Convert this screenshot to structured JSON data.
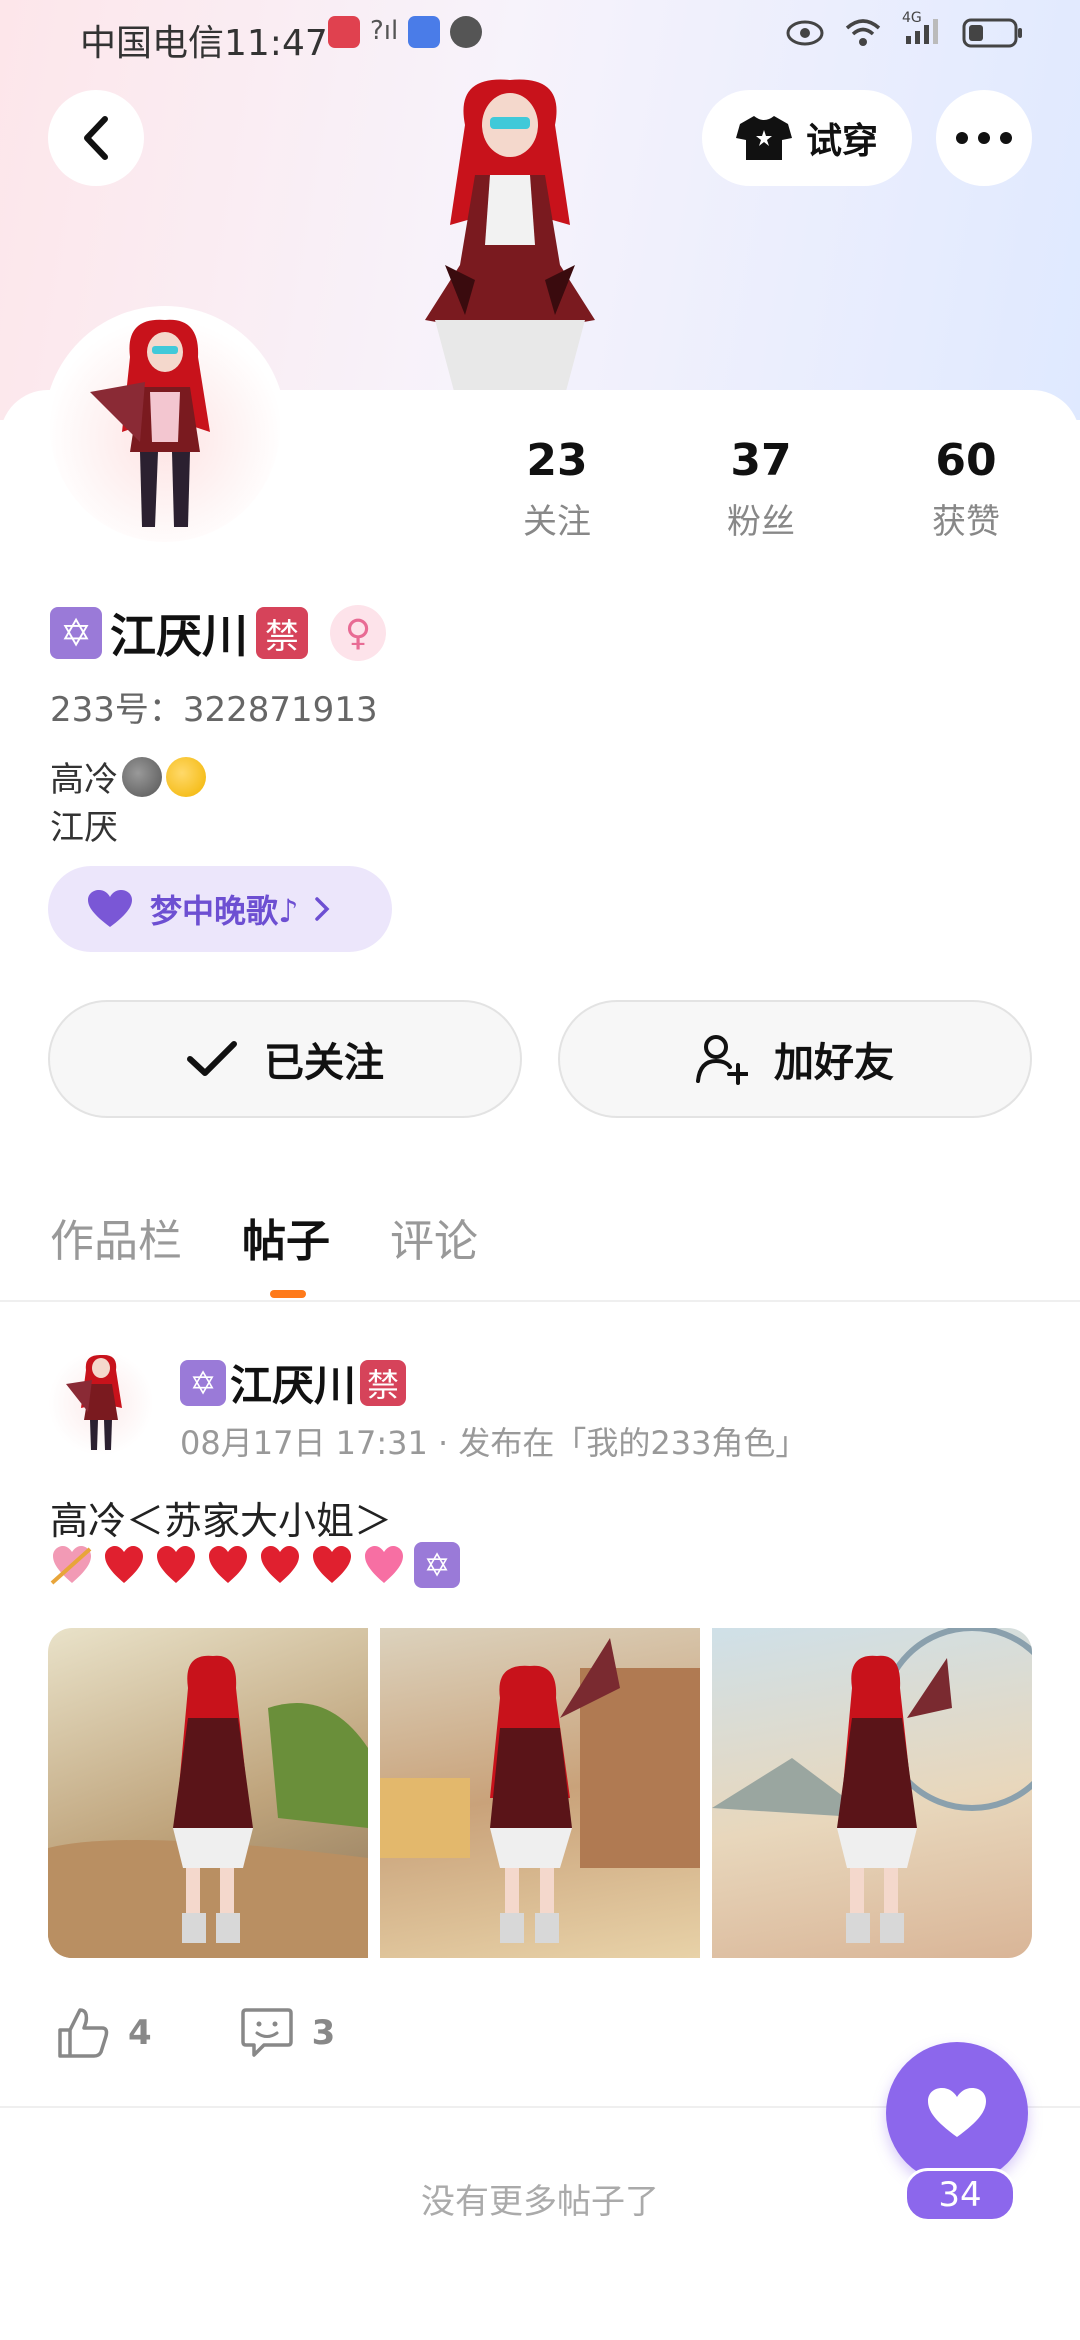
{
  "status_bar": {
    "carrier_time": "中国电信11:47",
    "signal_label": "4G"
  },
  "header": {
    "try_on_label": "试穿"
  },
  "profile": {
    "name": "江厌川",
    "star_badge": "✡",
    "ban_badge": "禁",
    "gender_symbol": "♀",
    "uid": "233号：322871913",
    "bio_line1": "高冷",
    "bio_line2": "江厌",
    "tag_label": "梦中晚歌♪",
    "stats": [
      {
        "value": "23",
        "label": "关注"
      },
      {
        "value": "37",
        "label": "粉丝"
      },
      {
        "value": "60",
        "label": "获赞"
      }
    ]
  },
  "buttons": {
    "followed_label": "已关注",
    "add_friend_label": "加好友"
  },
  "tabs": [
    {
      "label": "作品栏"
    },
    {
      "label": "帖子"
    },
    {
      "label": "评论"
    }
  ],
  "post": {
    "author": "江厌川",
    "meta": "08月17日 17:31 · 发布在「我的233角色」",
    "text": "高冷＜苏家大小姐＞",
    "likes": "4",
    "comments": "3"
  },
  "footer": {
    "no_more_label": "没有更多帖子了"
  },
  "fab": {
    "count": "34"
  },
  "colors": {
    "accent": "#8c67ec",
    "tab_indicator": "#ff7a1a",
    "ban_badge": "#d6435a",
    "star_badge": "#9a7ad8"
  }
}
